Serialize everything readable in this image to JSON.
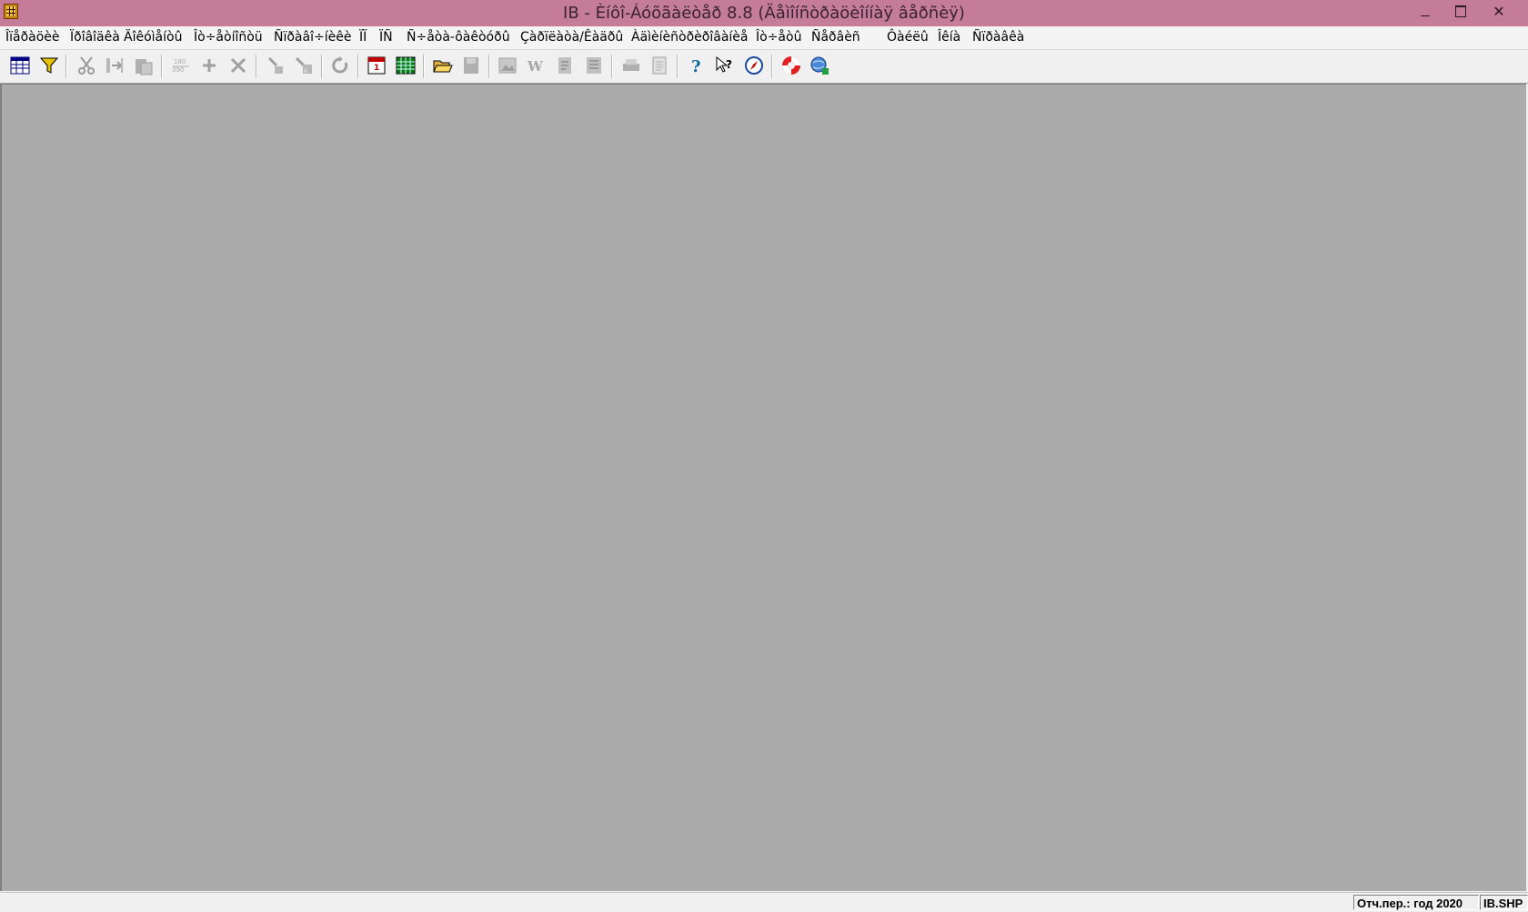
{
  "window": {
    "title": "IB - Èíôî-Áóõãàëòåð 8.8 (Äåìîíñòðàöèîííàÿ âåðñèÿ)",
    "minimize_glyph": "—",
    "close_glyph": "✕"
  },
  "menu": {
    "items": [
      {
        "label": "Îïåðàöèè"
      },
      {
        "label": "Ïðîâîäêà"
      },
      {
        "label": "Äîêóìåíòû"
      },
      {
        "label": "Îò÷åòíîñòü"
      },
      {
        "label": "Ñïðàâî÷íèêè"
      },
      {
        "label": "ÏÏ"
      },
      {
        "label": "ÏÑ"
      },
      {
        "label": "Ñ÷åòà-ôàêòóðû"
      },
      {
        "label": "Çàðïëàòà/Êàäðû"
      },
      {
        "label": "Àäìèíèñòðèðîâàíèå"
      },
      {
        "label": "Îò÷åòû"
      },
      {
        "label": "Ñåðâèñ"
      },
      {
        "label": "Ôàéëû"
      },
      {
        "label": "Îêíà"
      },
      {
        "label": "Ñïðàâêà"
      }
    ]
  },
  "toolbar": {
    "buttons": [
      {
        "icon": "table-view-icon",
        "enabled": true
      },
      {
        "icon": "filter-icon",
        "enabled": true
      },
      {
        "icon": "cut-icon",
        "enabled": false
      },
      {
        "icon": "copy-icon",
        "enabled": false
      },
      {
        "icon": "paste-icon",
        "enabled": false
      },
      {
        "icon": "numbering-icon",
        "enabled": false
      },
      {
        "icon": "add-icon",
        "enabled": false
      },
      {
        "icon": "delete-icon",
        "enabled": false
      },
      {
        "icon": "sort-icon",
        "enabled": false
      },
      {
        "icon": "sort-desc-icon",
        "enabled": false
      },
      {
        "icon": "refresh-icon",
        "enabled": false
      },
      {
        "icon": "calendar-icon",
        "enabled": true
      },
      {
        "icon": "spreadsheet-icon",
        "enabled": true
      },
      {
        "icon": "open-folder-icon",
        "enabled": true
      },
      {
        "icon": "save-icon",
        "enabled": false
      },
      {
        "icon": "image-icon",
        "enabled": false
      },
      {
        "icon": "word-icon",
        "enabled": false
      },
      {
        "icon": "report-icon",
        "enabled": false
      },
      {
        "icon": "list-icon",
        "enabled": false
      },
      {
        "icon": "print-icon",
        "enabled": false
      },
      {
        "icon": "preview-icon",
        "enabled": false
      },
      {
        "icon": "help-icon",
        "enabled": true
      },
      {
        "icon": "context-help-icon",
        "enabled": true
      },
      {
        "icon": "compass-icon",
        "enabled": true
      },
      {
        "icon": "lifebuoy-icon",
        "enabled": true
      },
      {
        "icon": "web-icon",
        "enabled": true
      }
    ]
  },
  "status": {
    "period": "Отч.пер.: год 2020",
    "file": "IB.SHP"
  },
  "colors": {
    "titlebar": "#c47c98",
    "workspace": "#ababab"
  }
}
